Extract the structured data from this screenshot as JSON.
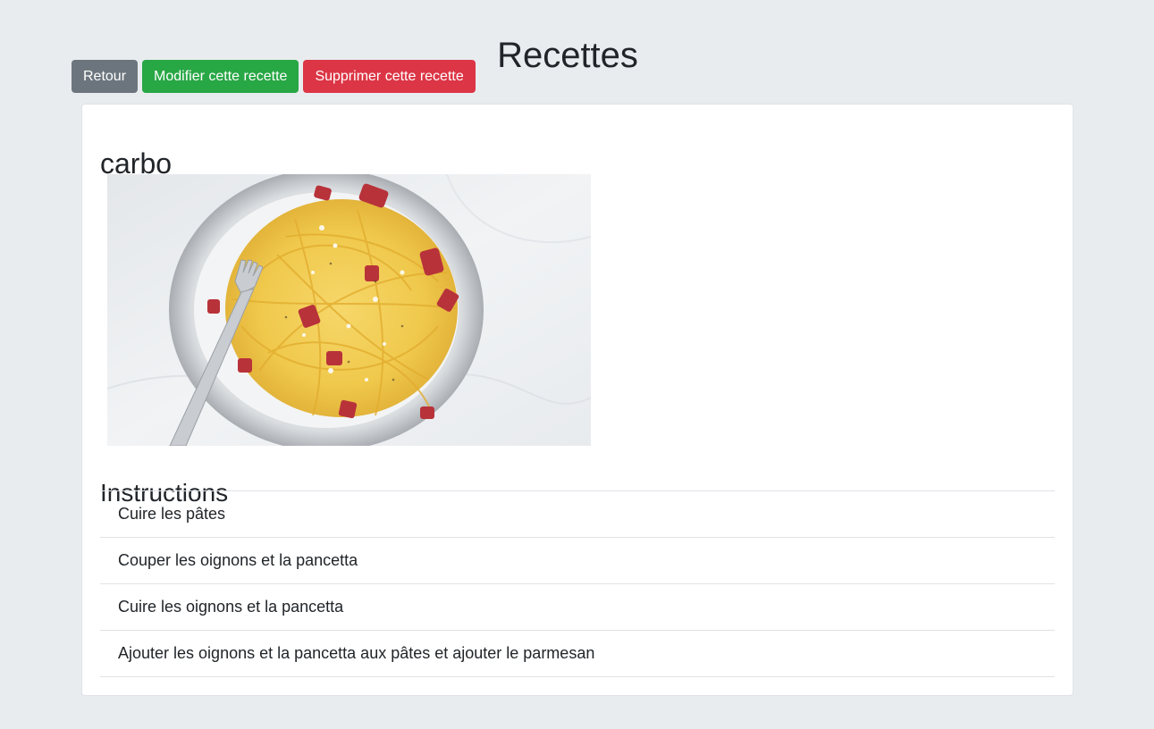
{
  "header": {
    "title": "Recettes"
  },
  "toolbar": {
    "back_label": "Retour",
    "edit_label": "Modifier cette recette",
    "delete_label": "Supprimer cette recette"
  },
  "recipe": {
    "name": "carbo",
    "image": "spaghetti-carbonara-photo",
    "instructions_heading": "Instructions",
    "steps": [
      "Cuire les pâtes",
      "Couper les oignons et la pancetta",
      "Cuire les oignons et la pancetta",
      "Ajouter les oignons et la pancetta aux pâtes et ajouter le parmesan"
    ]
  },
  "colors": {
    "background": "#e9ecef",
    "secondary": "#6c757d",
    "success": "#28a745",
    "danger": "#dc3545"
  }
}
